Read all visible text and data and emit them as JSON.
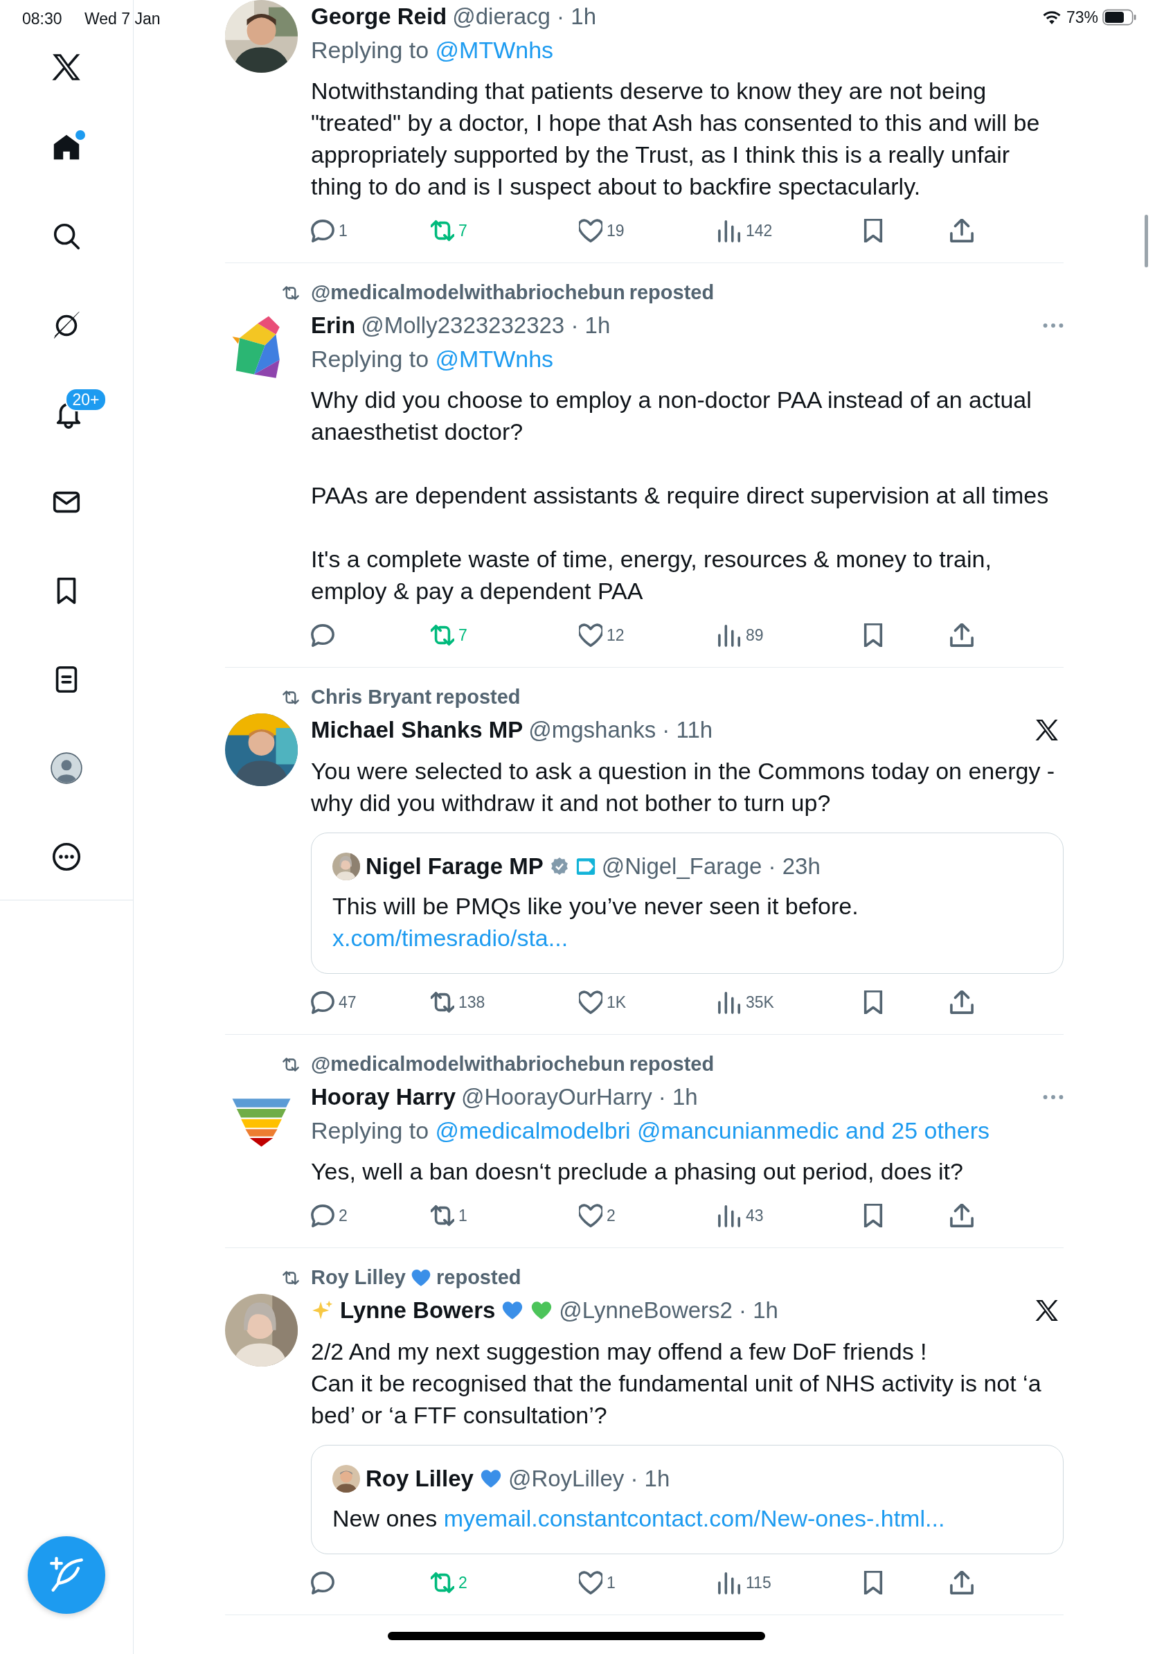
{
  "status_bar": {
    "time": "08:30",
    "date": "Wed 7 Jan",
    "battery": "73%"
  },
  "sidebar": {
    "items": [
      {
        "kind": "logo"
      },
      {
        "kind": "home",
        "unread": true
      },
      {
        "kind": "search"
      },
      {
        "kind": "grok"
      },
      {
        "kind": "notifications",
        "badge": "20+"
      },
      {
        "kind": "messages"
      },
      {
        "kind": "bookmarks"
      },
      {
        "kind": "lists"
      },
      {
        "kind": "profile"
      },
      {
        "kind": "more"
      }
    ]
  },
  "tweets": [
    {
      "name": "George Reid",
      "handle_time": "@dieracg · 1h",
      "replying_label": "Replying to",
      "replying_to": [
        "@MTWnhs"
      ],
      "text": "Notwithstanding that patients deserve to know they are not being \"treated\" by a doctor, I hope that Ash has consented to this and will be appropriately supported by the Trust, as I think this is a really unfair thing to do and is I suspect about to backfire spectacularly.",
      "stats": {
        "reply": "1",
        "repost": "7",
        "like": "19",
        "views": "142"
      },
      "reposted": true
    },
    {
      "reposter": "@medicalmodelwithabriochebun",
      "repost_label": "reposted",
      "name": "Erin",
      "handle_time": "@Molly2323232323 · 1h",
      "menu": {
        "kind": "more"
      },
      "replying_label": "Replying to",
      "replying_to": [
        "@MTWnhs"
      ],
      "text": "Why did you choose to employ a non-doctor PAA instead of an actual anaesthetist doctor?\n\nPAAs are dependent assistants & require direct supervision at all times\n\nIt's a complete waste of time, energy, resources & money to train, employ & pay a dependent PAA",
      "stats": {
        "repost": "7",
        "like": "12",
        "views": "89"
      },
      "reposted": true
    },
    {
      "reposter": "Chris Bryant",
      "repost_label": "reposted",
      "name": "Michael Shanks MP",
      "handle_time": "@mgshanks · 11h",
      "menu": {
        "kind": "x"
      },
      "text": "You were selected to ask a question in the Commons today on energy - why did you withdraw it and not bother to turn up?",
      "quote": {
        "name": "Nigel Farage MP",
        "badges": [
          {
            "kind": "verified"
          },
          {
            "kind": "affiliate"
          }
        ],
        "handle_time": "@Nigel_Farage · 23h",
        "text": "This will be PMQs like you’ve never seen it before. ",
        "link": "x.com/timesradio/sta..."
      },
      "stats": {
        "reply": "47",
        "repost": "138",
        "like": "1K",
        "views": "35K"
      },
      "reposted": false
    },
    {
      "reposter": "@medicalmodelwithabriochebun",
      "repost_label": "reposted",
      "name": "Hooray Harry",
      "handle_time": "@HoorayOurHarry · 1h",
      "menu": {
        "kind": "more"
      },
      "replying_label": "Replying to",
      "replying_to": [
        "@medicalmodelbri",
        "@mancunianmedic",
        "and 25 others"
      ],
      "text": "Yes, well a ban doesn‘t preclude a phasing out period, does it?",
      "stats": {
        "reply": "2",
        "repost": "1",
        "like": "2",
        "views": "43"
      },
      "reposted": false
    },
    {
      "reposter": "Roy Lilley",
      "reposter_emojis": [
        {
          "kind": "blue_heart"
        }
      ],
      "repost_label": "reposted",
      "name_prefix_emojis": [
        {
          "kind": "sparkles"
        }
      ],
      "name": "Lynne Bowers",
      "name_emojis": [
        {
          "kind": "blue_heart"
        },
        {
          "kind": "green_heart"
        }
      ],
      "handle_time": "@LynneBowers2 · 1h",
      "menu": {
        "kind": "x"
      },
      "text": "2/2 And my next suggestion may offend a few DoF friends !\nCan it be recognised that the fundamental unit of NHS activity is not ‘a bed’ or ‘a FTF consultation’?",
      "quote": {
        "name": "Roy Lilley",
        "name_emojis": [
          {
            "kind": "blue_heart"
          }
        ],
        "handle_time": "@RoyLilley · 1h",
        "text": "New ones ",
        "link": "myemail.constantcontact.com/New-ones-.html..."
      },
      "stats": {
        "repost": "2",
        "like": "1",
        "views": "115"
      },
      "reposted": true
    }
  ]
}
